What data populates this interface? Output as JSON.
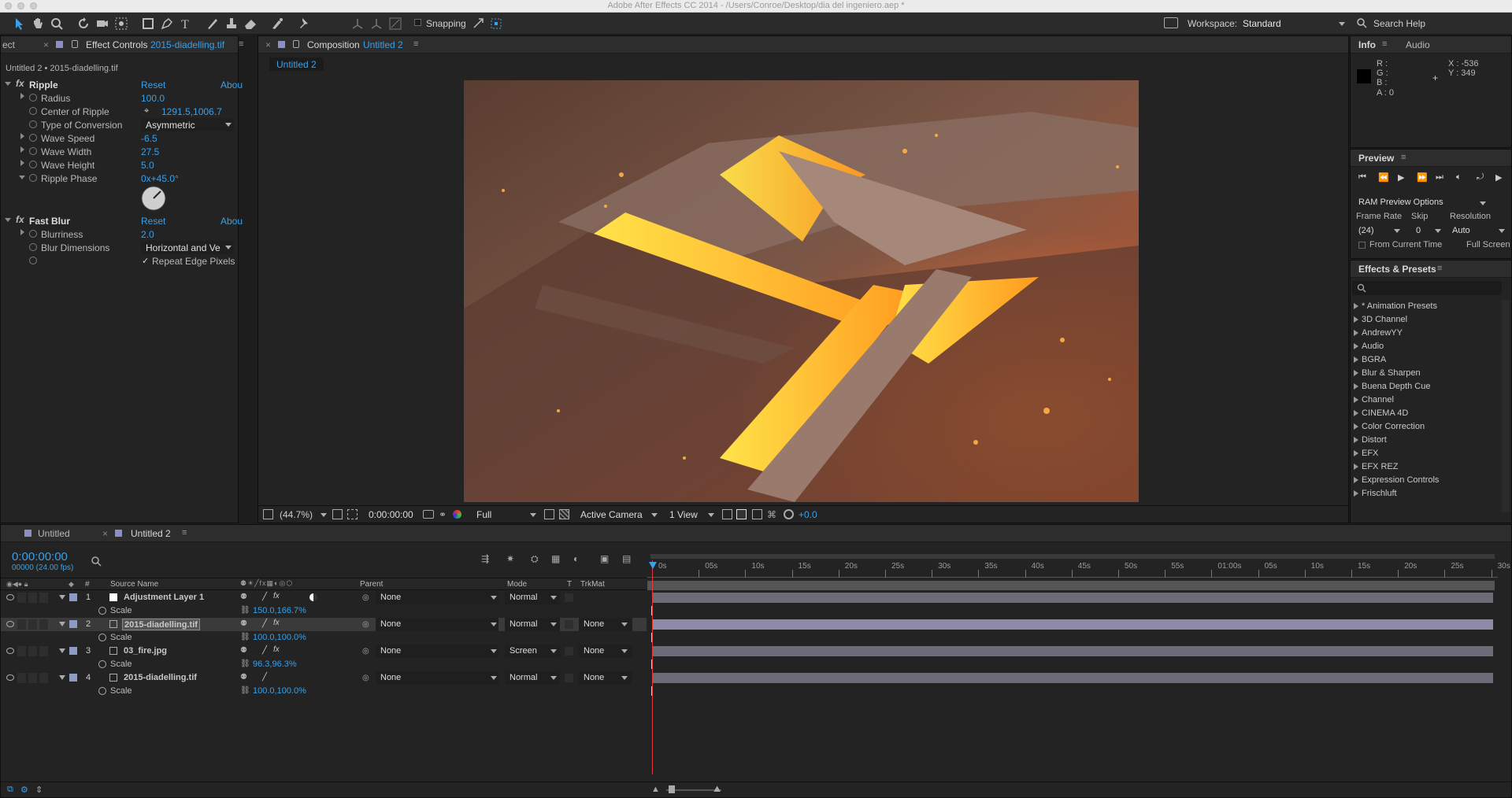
{
  "window": {
    "title": "Adobe After Effects CC 2014 - /Users/Conroe/Desktop/dia del ingeniero.aep *"
  },
  "toolbar": {
    "snapping": "Snapping",
    "workspace_label": "Workspace:",
    "workspace_value": "Standard",
    "search_help": "Search Help"
  },
  "effect_controls": {
    "tab_left": "ect",
    "tab_title": "Effect Controls",
    "tab_file": "2015-diadelling.tif",
    "subtitle": "Untitled 2 • 2015-diadelling.tif",
    "reset": "Reset",
    "about": "Abou",
    "ripple": {
      "name": "Ripple",
      "radius_label": "Radius",
      "radius": "100.0",
      "center_label": "Center of Ripple",
      "center": "1291.5,1006.7",
      "conversion_label": "Type of Conversion",
      "conversion": "Asymmetric",
      "speed_label": "Wave Speed",
      "speed": "-6.5",
      "width_label": "Wave Width",
      "width": "27.5",
      "height_label": "Wave Height",
      "height": "5.0",
      "phase_label": "Ripple Phase",
      "phase": "0x+45.0°"
    },
    "blur": {
      "name": "Fast Blur",
      "blurriness_label": "Blurriness",
      "blurriness": "2.0",
      "dimensions_label": "Blur Dimensions",
      "dimensions": "Horizontal and Ve",
      "repeat_label": "Repeat Edge Pixels",
      "repeat_check": "✓"
    }
  },
  "composition": {
    "tab_label": "Composition",
    "tab_name": "Untitled 2",
    "flow_tab": "Untitled 2",
    "zoom": "(44.7%)",
    "timecode": "0:00:00:00",
    "resolution": "Full",
    "camera": "Active Camera",
    "view": "1 View",
    "exposure": "+0.0"
  },
  "info": {
    "tab": "Info",
    "tab2": "Audio",
    "r": "R :",
    "g": "G :",
    "b": "B :",
    "a": "A : 0",
    "x": "X : -536",
    "y": "Y : 349"
  },
  "preview": {
    "tab": "Preview",
    "ram_options": "RAM Preview Options",
    "frame_rate_label": "Frame Rate",
    "skip_label": "Skip",
    "resolution_label": "Resolution",
    "frame_rate": "(24)",
    "skip": "0",
    "resolution": "Auto",
    "from_current": "From Current Time",
    "full_screen": "Full Screen"
  },
  "effects_presets": {
    "tab": "Effects & Presets",
    "items": [
      "* Animation Presets",
      "3D Channel",
      "AndrewYY",
      "Audio",
      "BGRA",
      "Blur & Sharpen",
      "Buena Depth Cue",
      "Channel",
      "CINEMA 4D",
      "Color Correction",
      "Distort",
      "EFX",
      "EFX REZ",
      "Expression Controls",
      "Frischluft"
    ]
  },
  "timeline": {
    "tab1": "Untitled",
    "tab2": "Untitled 2",
    "timecode": "0:00:00:00",
    "fps": "00000 (24.00 fps)",
    "col_hash": "#",
    "col_source": "Source Name",
    "col_parent": "Parent",
    "col_mode": "Mode",
    "col_t": "T",
    "col_trkmat": "TrkMat",
    "ruler": [
      "0s",
      "05s",
      "10s",
      "15s",
      "20s",
      "25s",
      "30s",
      "35s",
      "40s",
      "45s",
      "50s",
      "55s",
      "01:00s",
      "05s",
      "10s",
      "15s",
      "20s",
      "25s",
      "30s"
    ],
    "layers": [
      {
        "num": "1",
        "name": "Adjustment Layer 1",
        "parent": "None",
        "mode": "Normal",
        "trkmat": "",
        "prop": "Scale",
        "value": "150.0,166.7%",
        "color": "#8b9bc3"
      },
      {
        "num": "2",
        "name": "2015-diadelling.tif",
        "parent": "None",
        "mode": "Normal",
        "trkmat": "None",
        "prop": "Scale",
        "value": "100.0,100.0%",
        "color": "#8b9bc3"
      },
      {
        "num": "3",
        "name": "03_fire.jpg",
        "parent": "None",
        "mode": "Screen",
        "trkmat": "None",
        "prop": "Scale",
        "value": "96.3,96.3%",
        "color": "#8b9bc3"
      },
      {
        "num": "4",
        "name": "2015-diadelling.tif",
        "parent": "None",
        "mode": "Normal",
        "trkmat": "None",
        "prop": "Scale",
        "value": "100.0,100.0%",
        "color": "#8b9bc3"
      }
    ]
  }
}
